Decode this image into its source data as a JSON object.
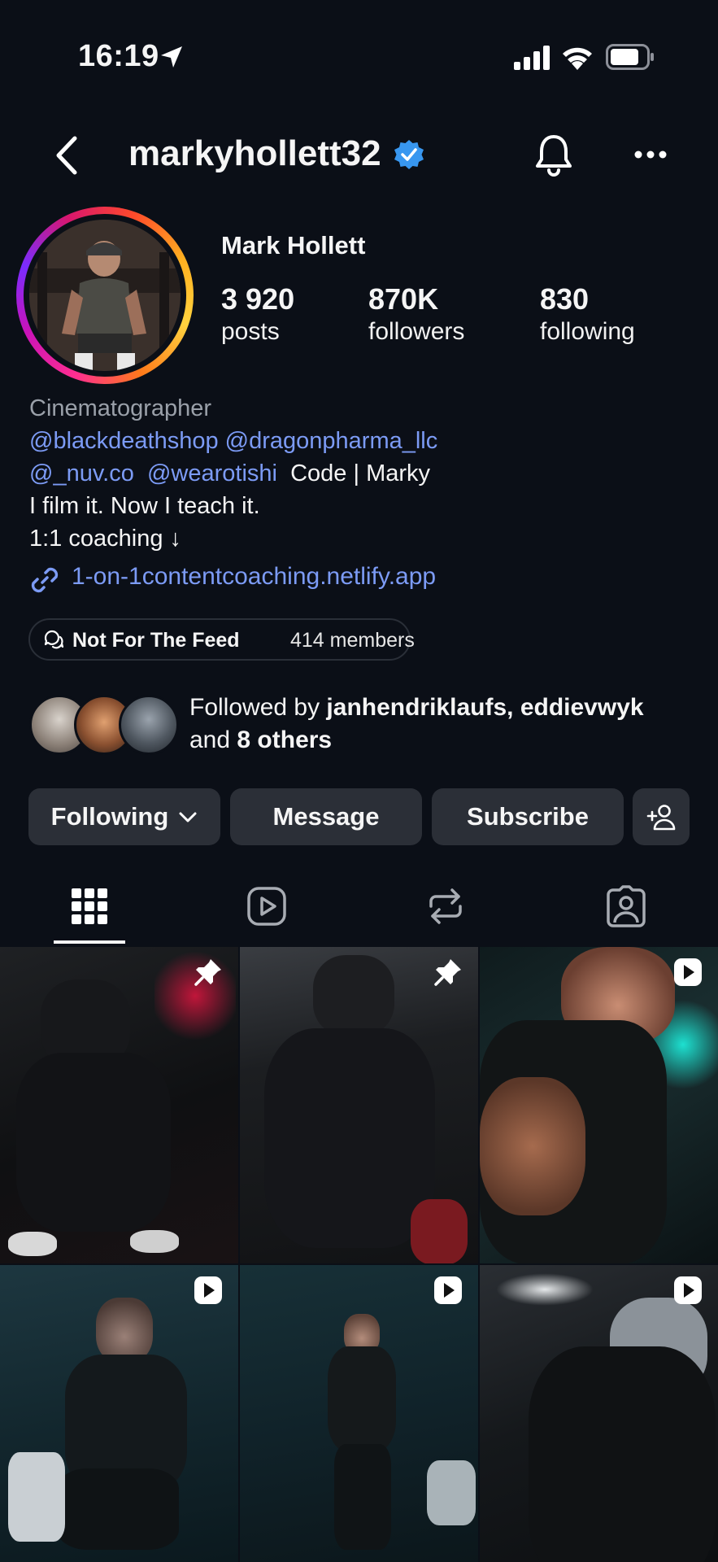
{
  "status_bar": {
    "time": "16:19",
    "icons": [
      "location-arrow-icon",
      "signal-icon",
      "wifi-icon",
      "battery-icon"
    ]
  },
  "header": {
    "username": "markyhollett32",
    "verified": true,
    "icons": [
      "back-icon",
      "verified-icon",
      "bell-icon",
      "more-icon"
    ]
  },
  "profile": {
    "display_name": "Mark Hollett",
    "stats": [
      {
        "value": "3 920",
        "label": "posts"
      },
      {
        "value": "870K",
        "label": "followers"
      },
      {
        "value": "830",
        "label": "following"
      }
    ]
  },
  "bio": {
    "category": "Cinematographer",
    "line2": {
      "mention1": "@blackdeathshop",
      "mention2": "@dragonpharma_llc"
    },
    "line3": {
      "mention1": "@_nuv.co",
      "mention2": "@wearotishi",
      "text": "Code | Marky"
    },
    "line4": "I film it. Now I teach it.",
    "line5": "1:1 coaching ↓",
    "link": "1-on-1contentcoaching.netlify.app"
  },
  "channel": {
    "name": "Not For The Feed",
    "members": "414 members"
  },
  "followed_by": {
    "prefix": "Followed by",
    "user1": "janhendriklaufs,",
    "user2": "eddievwyk",
    "and": "and",
    "others": "8 others"
  },
  "actions": {
    "following": "Following",
    "message": "Message",
    "subscribe": "Subscribe"
  },
  "tabs": [
    "grid-icon",
    "reels-icon",
    "reposts-icon",
    "tagged-icon"
  ],
  "posts": [
    {
      "badge": "pin-icon"
    },
    {
      "badge": "pin-icon"
    },
    {
      "badge": "reel-icon"
    },
    {
      "badge": "reel-icon"
    },
    {
      "badge": "reel-icon"
    },
    {
      "badge": "reel-icon"
    }
  ],
  "colors": {
    "background": "#0b0f17",
    "link": "#7c9bf5",
    "verified": "#3897f0",
    "button": "#2b2f37"
  }
}
